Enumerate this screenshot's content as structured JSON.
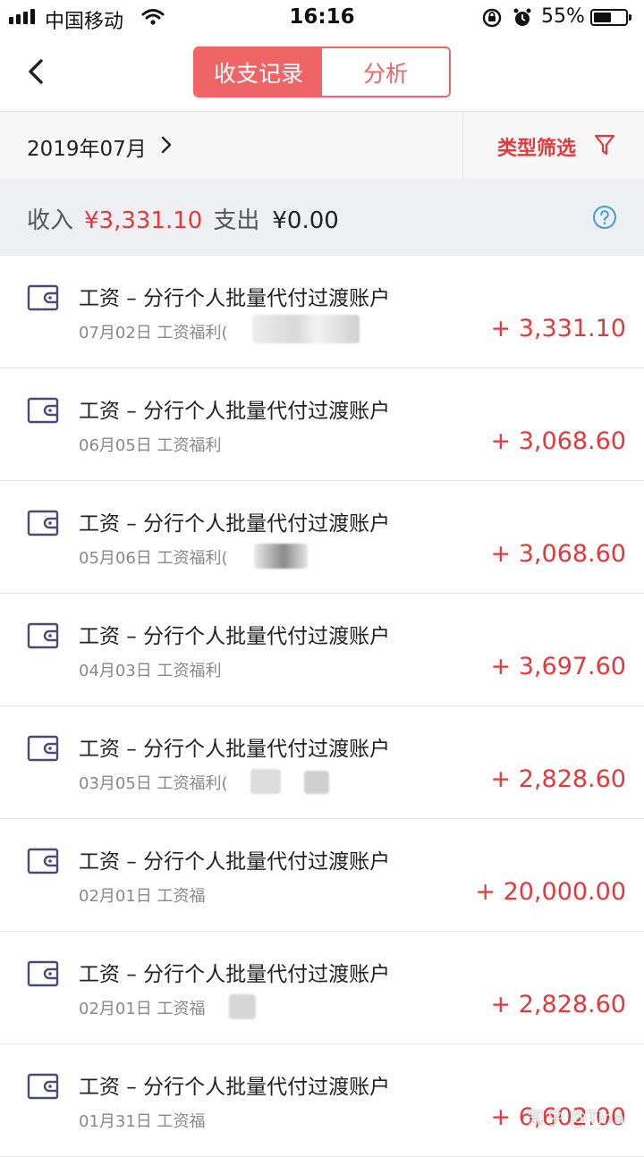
{
  "status_bar": {
    "carrier": "中国移动",
    "time": "16:16",
    "battery": "55%",
    "battery_level": 0.55
  },
  "nav": {
    "tabs": [
      "收支记录",
      "分析"
    ],
    "active_tab": 0
  },
  "filter": {
    "month": "2019年07月",
    "type_filter": "类型筛选"
  },
  "summary": {
    "income_label": "收入",
    "income_value": "¥3,331.10",
    "expense_label": "支出",
    "expense_value": "¥0.00"
  },
  "records": [
    {
      "title": "工资 – 分行个人批量代付过渡账户",
      "subtitle": "07月02日 工资福利(",
      "amount": "+ 3,331.10"
    },
    {
      "title": "工资 – 分行个人批量代付过渡账户",
      "subtitle": "06月05日 工资福利",
      "amount": "+ 3,068.60"
    },
    {
      "title": "工资 – 分行个人批量代付过渡账户",
      "subtitle": "05月06日 工资福利(",
      "amount": "+ 3,068.60"
    },
    {
      "title": "工资 – 分行个人批量代付过渡账户",
      "subtitle": "04月03日 工资福利",
      "amount": "+ 3,697.60"
    },
    {
      "title": "工资 – 分行个人批量代付过渡账户",
      "subtitle": "03月05日 工资福利(",
      "amount": "+ 2,828.60"
    },
    {
      "title": "工资 – 分行个人批量代付过渡账户",
      "subtitle": "02月01日 工资福",
      "amount": "+ 20,000.00"
    },
    {
      "title": "工资 – 分行个人批量代付过渡账户",
      "subtitle": "02月01日 工资福",
      "amount": "+ 2,828.60"
    },
    {
      "title": "工资 – 分行个人批量代付过渡账户",
      "subtitle": "01月31日 工资福",
      "amount": "+ 6,602.00"
    }
  ],
  "watermark": "知乎 @Tina",
  "colors": {
    "accent": "#f06466",
    "amount_red": "#e4393c"
  }
}
